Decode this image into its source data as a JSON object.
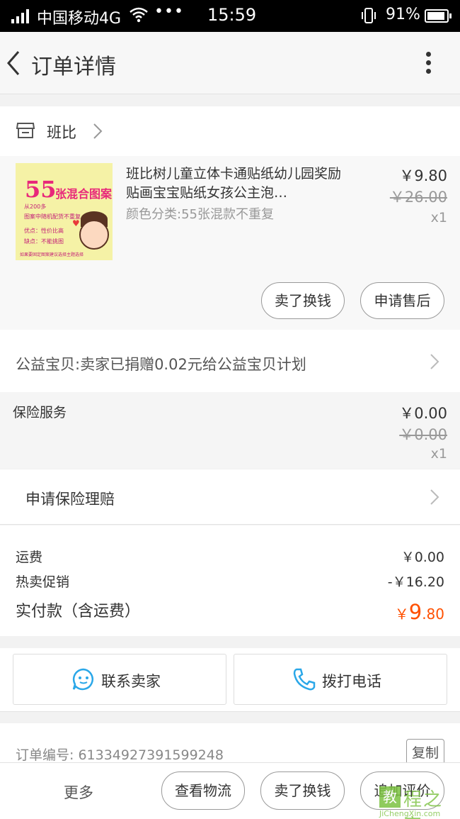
{
  "status_bar": {
    "carrier": "中国移动4G",
    "dots": "•••",
    "time": "15:59",
    "battery": "91%",
    "battery_level": 0.91
  },
  "nav": {
    "title": "订单详情",
    "back_icon": "chevron-left-icon",
    "more_icon": "vertical-dots-icon"
  },
  "shop": {
    "name": "班比",
    "icon": "store-icon"
  },
  "item": {
    "name": "班比树儿童立体卡通贴纸幼儿园奖励贴画宝宝贴纸女孩公主泡…",
    "sku": "颜色分类:55张混款不重复",
    "price": "￥9.80",
    "original_price": "￥26.00",
    "quantity": "x1",
    "thumb": {
      "big": "55",
      "title": "张混合图案",
      "line1": "从200多",
      "line2": "图案中随机配货不重复",
      "line3": "优点：性价比高",
      "line4": "缺点：不能挑图",
      "line5": "如果要固定图案建议选择主题选择"
    },
    "buttons": {
      "sell": "卖了换钱",
      "after_sale": "申请售后"
    }
  },
  "charity": {
    "text": "公益宝贝:卖家已捐赠0.02元给公益宝贝计划"
  },
  "insurance": {
    "label": "保险服务",
    "price": "￥0.00",
    "original_price": "￥0.00",
    "quantity": "x1"
  },
  "claim": {
    "text": "申请保险理赔"
  },
  "fees": {
    "shipping_label": "运费",
    "shipping_value": "￥0.00",
    "promo_label": "热卖促销",
    "promo_value": "-￥16.20",
    "total_label": "实付款（含运费）",
    "total_currency": "￥",
    "total_int": "9",
    "total_dec": ".80"
  },
  "contact": {
    "seller": "联系卖家",
    "phone": "拨打电话",
    "seller_icon": "chat-bubble-icon",
    "phone_icon": "phone-icon"
  },
  "order": {
    "number_text": "订单编号: 61334927391599248",
    "copy": "复制"
  },
  "bottom": {
    "more": "更多",
    "track": "查看物流",
    "sell": "卖了换钱",
    "review": "追加评价"
  },
  "watermark": {
    "box": "教",
    "text": "程之家",
    "url": "JiChengXin.com"
  },
  "colors": {
    "accent_orange": "#ff5000",
    "icon_blue": "#2aa7e8"
  }
}
